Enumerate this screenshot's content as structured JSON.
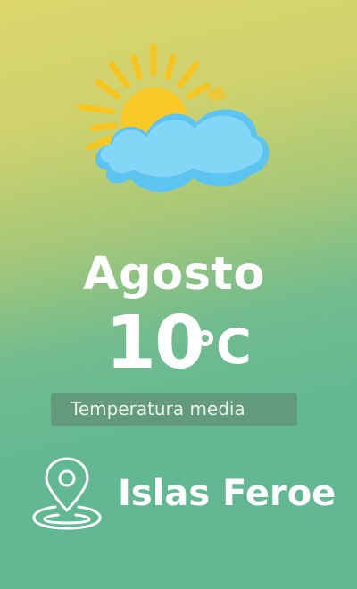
{
  "weather": {
    "icon": "sun-behind-cloud-icon",
    "month": "Agosto",
    "temperature": "10",
    "unit": "C",
    "caption": "Temperatura media"
  },
  "location": {
    "icon": "map-pin-icon",
    "name": "Islas Feroe"
  },
  "colors": {
    "background_top": "#dcd66c",
    "background_bottom": "#62b893",
    "sun": "#f9c928",
    "cloud": "#7fd3f4",
    "text": "#ffffff"
  }
}
